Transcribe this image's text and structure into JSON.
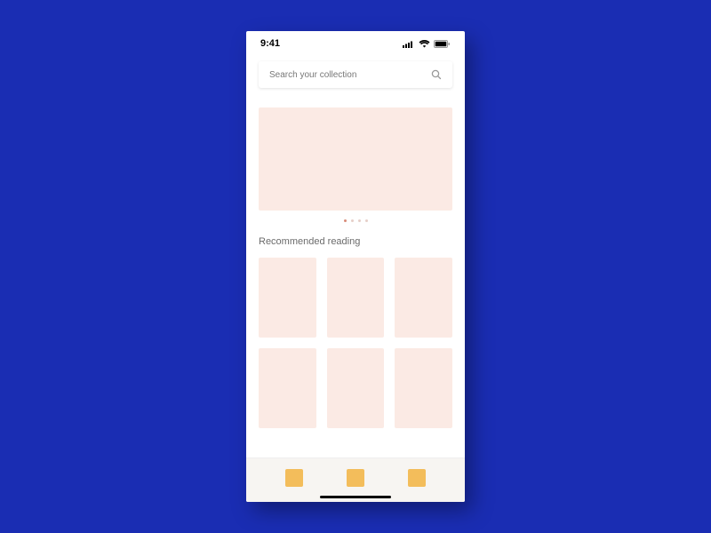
{
  "status": {
    "time": "9:41"
  },
  "search": {
    "placeholder": "Search your collection"
  },
  "hero": {
    "dot_count": 4,
    "active_dot": 0
  },
  "section": {
    "title": "Recommended reading"
  },
  "grid": {
    "count": 6
  },
  "tabs": {
    "count": 3
  },
  "colors": {
    "bg": "#1a2db3",
    "card": "#fbeae4",
    "tab": "#f3bd5b",
    "tabbar": "#f7f5f2"
  }
}
